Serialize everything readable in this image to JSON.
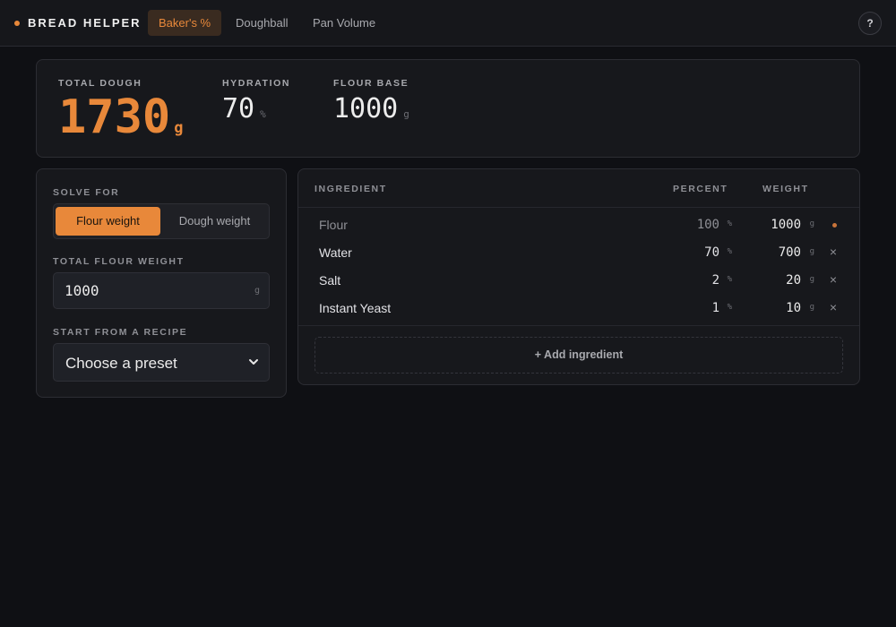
{
  "app": {
    "brand": "BREAD HELPER"
  },
  "nav": {
    "tabs": [
      {
        "label": "Baker's %",
        "active": true
      },
      {
        "label": "Doughball",
        "active": false
      },
      {
        "label": "Pan Volume",
        "active": false
      }
    ],
    "help_label": "?"
  },
  "summary": {
    "total_dough": {
      "label": "TOTAL DOUGH",
      "value": "1730",
      "unit": "g"
    },
    "hydration": {
      "label": "HYDRATION",
      "value": "70",
      "unit": "%"
    },
    "flour_base": {
      "label": "FLOUR BASE",
      "value": "1000",
      "unit": "g"
    }
  },
  "solve_for": {
    "label": "SOLVE FOR",
    "options": [
      {
        "label": "Flour weight",
        "active": true
      },
      {
        "label": "Dough weight",
        "active": false
      }
    ]
  },
  "flour_input": {
    "label": "TOTAL FLOUR WEIGHT",
    "value": "1000",
    "unit": "g"
  },
  "recipe": {
    "label": "START FROM A RECIPE",
    "selected": "Choose a preset"
  },
  "table": {
    "headers": {
      "ingredient": "INGREDIENT",
      "percent": "PERCENT",
      "weight": "WEIGHT"
    },
    "rows": [
      {
        "name": "Flour",
        "percent": "100",
        "percent_unit": "%",
        "weight": "1000",
        "weight_unit": "g",
        "base": true
      },
      {
        "name": "Water",
        "percent": "70",
        "percent_unit": "%",
        "weight": "700",
        "weight_unit": "g",
        "remove": "×"
      },
      {
        "name": "Salt",
        "percent": "2",
        "percent_unit": "%",
        "weight": "20",
        "weight_unit": "g",
        "remove": "×"
      },
      {
        "name": "Instant Yeast",
        "percent": "1",
        "percent_unit": "%",
        "weight": "10",
        "weight_unit": "g",
        "remove": "×"
      }
    ],
    "add_label": "+ Add ingredient"
  },
  "colors": {
    "accent": "#e8883a",
    "background": "#0f1014",
    "panel": "#17181c"
  },
  "icons": {
    "brand": "dot-icon",
    "select": "chevron-down-icon",
    "remove": "close-icon"
  }
}
